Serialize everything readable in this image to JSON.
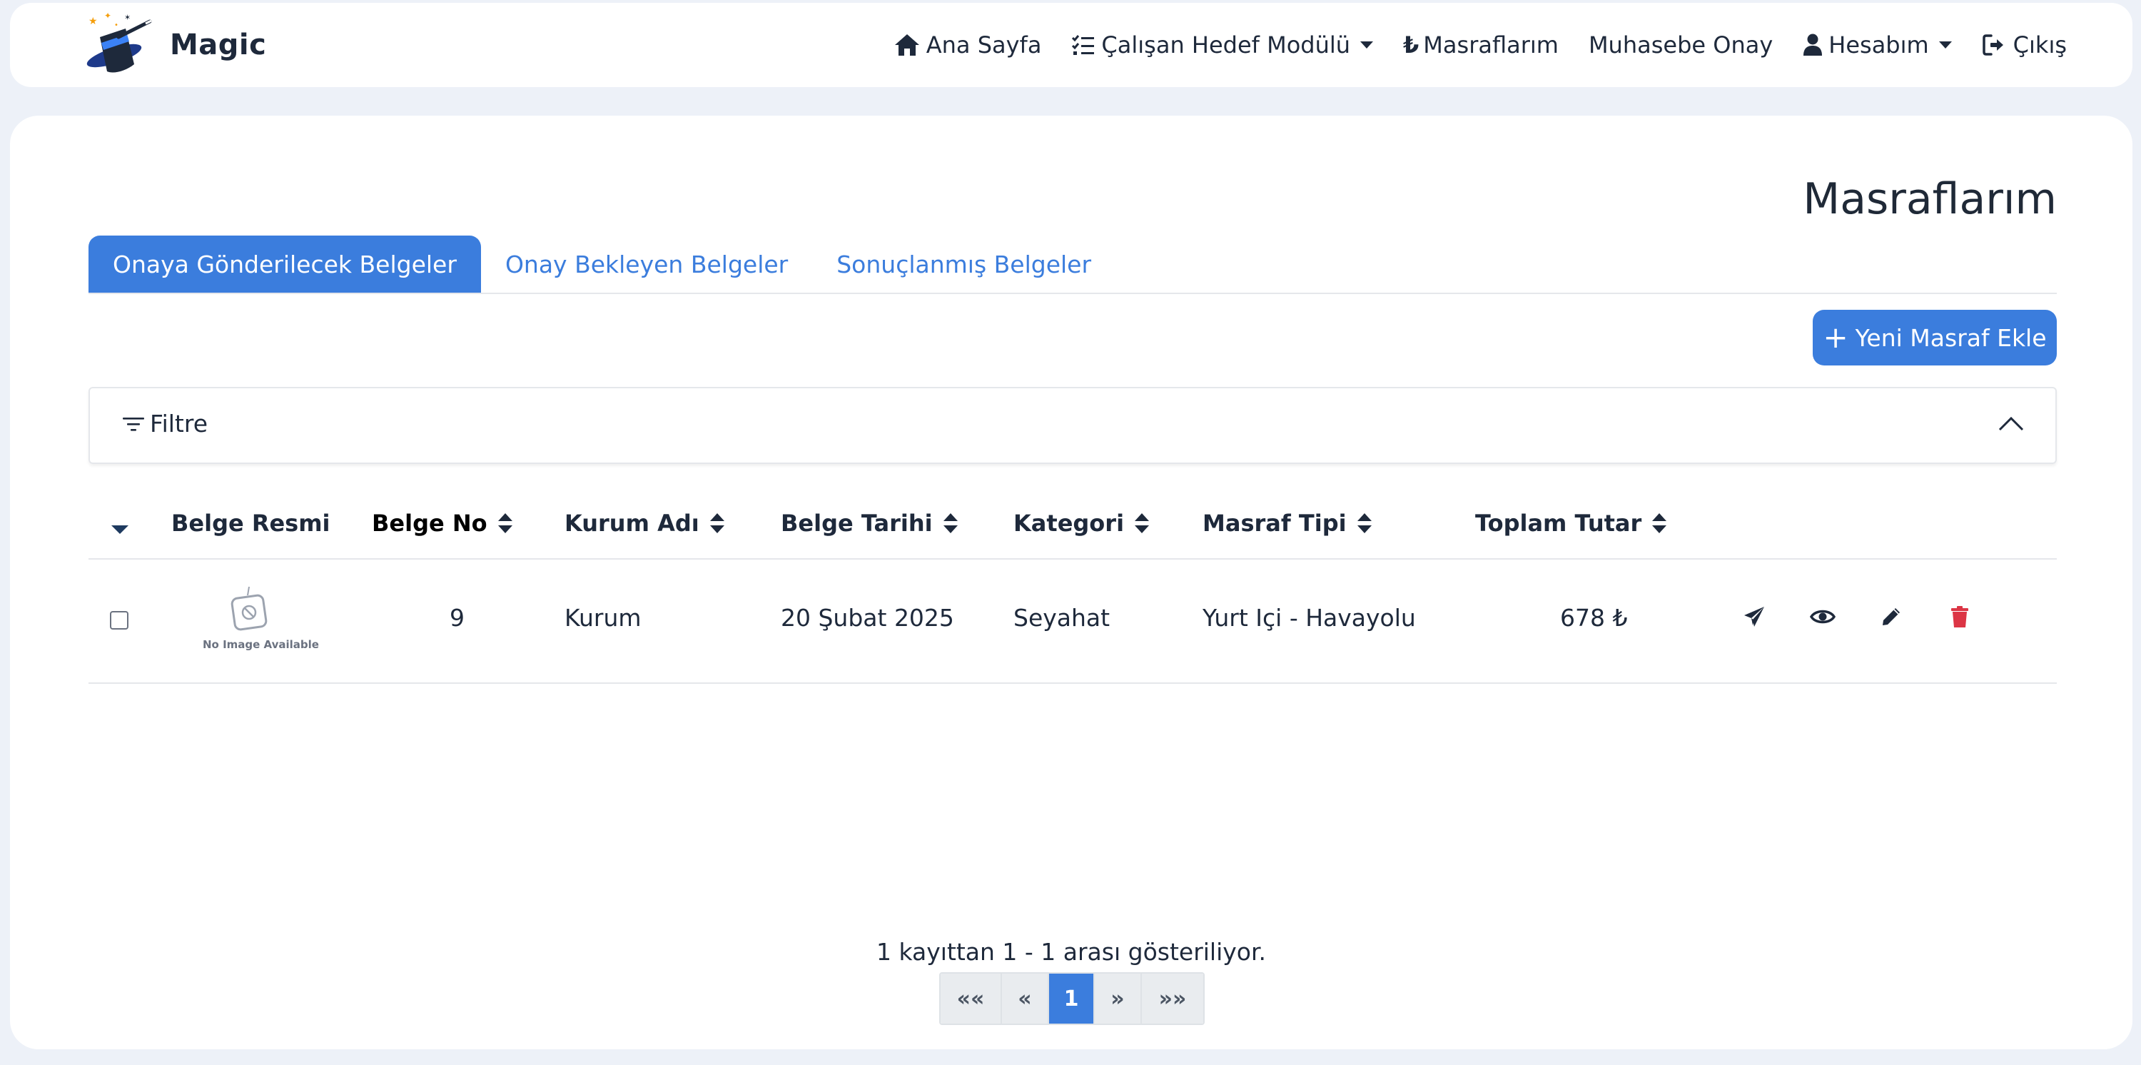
{
  "brand": {
    "name": "Magic"
  },
  "nav": {
    "home": "Ana Sayfa",
    "goals": "Çalışan Hedef Modülü",
    "expenses": "Masraflarım",
    "accounting": "Muhasebe Onay",
    "account": "Hesabım",
    "logout": "Çıkış"
  },
  "page": {
    "title": "Masraflarım"
  },
  "tabs": [
    {
      "label": "Onaya Gönderilecek Belgeler",
      "active": true
    },
    {
      "label": "Onay Bekleyen Belgeler",
      "active": false
    },
    {
      "label": "Sonuçlanmış Belgeler",
      "active": false
    }
  ],
  "add_button": {
    "label": "Yeni Masraf Ekle"
  },
  "filter": {
    "label": "Filtre"
  },
  "table": {
    "headers": [
      "Belge Resmi",
      "Belge No",
      "Kurum Adı",
      "Belge Tarihi",
      "Kategori",
      "Masraf Tipi",
      "Toplam Tutar"
    ],
    "rows": [
      {
        "image_text": "No Image Available",
        "belge_no": "9",
        "kurum_adi": "Kurum",
        "belge_tarihi": "20 Şubat 2025",
        "kategori": "Seyahat",
        "masraf_tipi": "Yurt Içi - Havayolu",
        "toplam_tutar": "678 ₺"
      }
    ]
  },
  "pagination": {
    "info": "1 kayıttan 1 - 1 arası gösteriliyor.",
    "first": "««",
    "prev": "«",
    "current": "1",
    "next": "»",
    "last": "»»"
  },
  "colors": {
    "accent": "#3b7ddd",
    "delete": "#dc3545",
    "background": "#edf1f8"
  },
  "icons": {
    "home": "home-icon",
    "goals": "checklist-icon",
    "expenses": "lira-icon",
    "account": "user-icon",
    "logout": "logout-icon",
    "filter": "filter-lines-icon",
    "toggle": "chevron-up-icon",
    "send": "paper-plane-icon",
    "view": "eye-icon",
    "edit": "pencil-icon",
    "delete": "trash-icon"
  }
}
